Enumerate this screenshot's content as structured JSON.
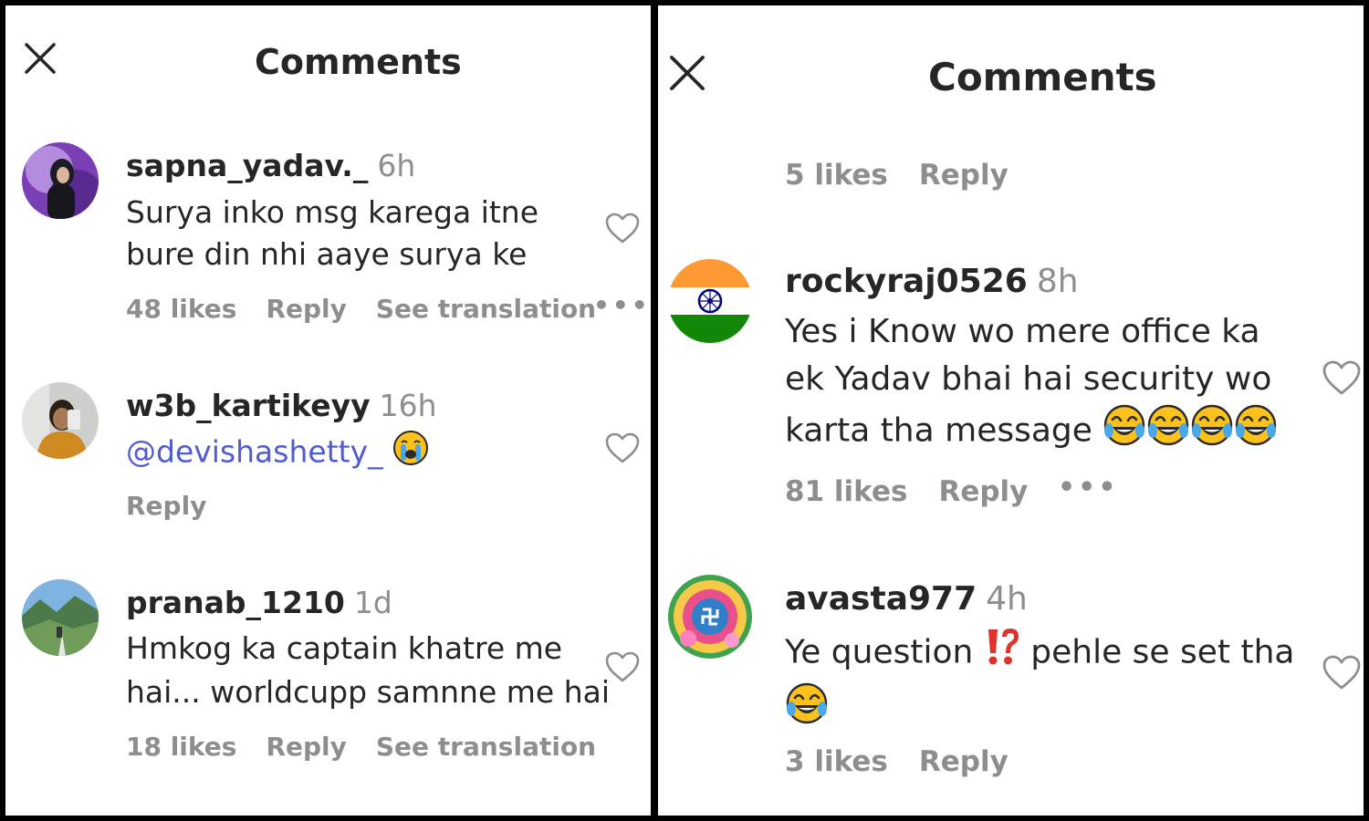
{
  "left": {
    "title": "Comments",
    "comments": [
      {
        "username": "sapna_yadav._",
        "time": "6h",
        "lines": [
          "Surya inko msg karega itne",
          "bure din nhi aaye surya ke"
        ],
        "likes": "48 likes",
        "reply": "Reply",
        "translate": "See translation"
      },
      {
        "username": "w3b_kartikeyy",
        "time": "16h",
        "mention": "@devishashetty_",
        "emoji": "crying-face",
        "reply": "Reply"
      },
      {
        "username": "pranab_1210",
        "time": "1d",
        "lines": [
          "Hmkog ka captain khatre me",
          "hai... worldcupp samnne me hai"
        ],
        "likes": "18 likes",
        "reply": "Reply",
        "translate": "See translation"
      }
    ]
  },
  "right": {
    "title": "Comments",
    "top": {
      "likes": "5 likes",
      "reply": "Reply"
    },
    "comments": [
      {
        "username": "rockyraj0526",
        "time": "8h",
        "lines": [
          "Yes i Know wo mere office ka",
          "ek Yadav bhai hai security wo",
          "karta tha message"
        ],
        "emoji": "tears-of-joy x4",
        "likes": "81 likes",
        "reply": "Reply"
      },
      {
        "username": "avasta977",
        "time": "4h",
        "line_a": "Ye question",
        "emoji_mid": "exclamation-question-mark",
        "line_b": "pehle se set tha",
        "emoji": "tears-of-joy",
        "likes": "3 likes",
        "reply": "Reply"
      }
    ]
  },
  "colors": {
    "text": "#262626",
    "muted": "#8e8e8e",
    "mention": "#4f5bd5",
    "background": "#ffffff"
  }
}
